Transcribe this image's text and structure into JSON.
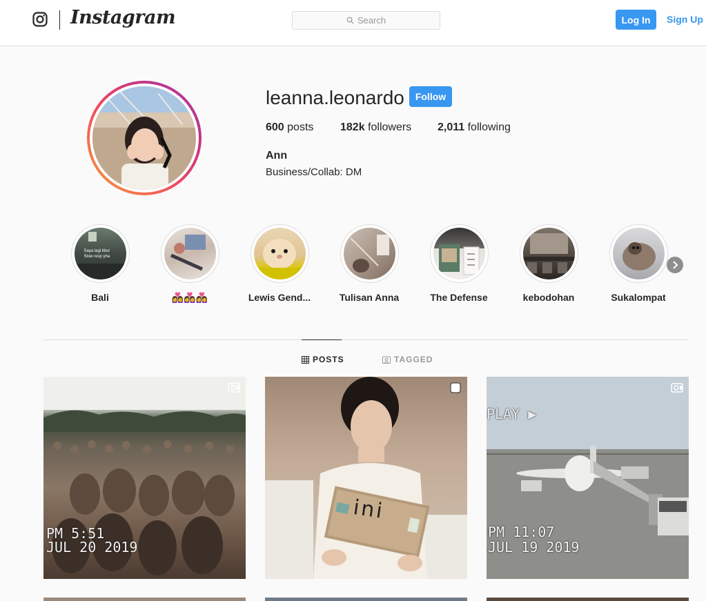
{
  "header": {
    "logo_wordmark": "Instagram",
    "search_placeholder": "Search",
    "login_label": "Log In",
    "signup_label": "Sign Up"
  },
  "profile": {
    "username": "leanna.leonardo",
    "follow_label": "Follow",
    "stats": {
      "posts_count": "600",
      "posts_label": "posts",
      "followers_count": "182k",
      "followers_label": "followers",
      "following_count": "2,011",
      "following_label": "following"
    },
    "full_name": "Ann",
    "bio": "Business/Collab: DM"
  },
  "highlights": [
    {
      "label": "Bali",
      "caption": "Saya lagi libur\nSlow resp yha"
    },
    {
      "label": "👩‍❤️‍👩👩‍❤️‍👩👩‍❤️‍👩"
    },
    {
      "label": "Lewis Gend..."
    },
    {
      "label": "Tulisan Anna"
    },
    {
      "label": "The Defense"
    },
    {
      "label": "kebodohan"
    },
    {
      "label": "Sukalompat"
    }
  ],
  "tabs": {
    "posts_label": "POSTS",
    "tagged_label": "TAGGED"
  },
  "posts": [
    {
      "type": "video",
      "overlay_line1": "PM  5:51",
      "overlay_line2": "JUL 20 2019"
    },
    {
      "type": "multiple",
      "overlay_text": "ini"
    },
    {
      "type": "video",
      "overlay_line0": "PLAY ▶",
      "overlay_line1": "PM  11:07",
      "overlay_line2": "JUL 19 2019"
    }
  ],
  "icons": {
    "logo": "instagram-glyph-icon",
    "search": "search-icon",
    "next": "chevron-right-icon",
    "posts_tab": "grid-icon",
    "tagged_tab": "tagged-icon",
    "video": "video-camera-icon",
    "multiple": "multiple-posts-icon"
  },
  "colors": {
    "accent": "#3897f0",
    "text": "#262626",
    "muted": "#999999",
    "border": "#dbdbdb",
    "background": "#fafafa"
  }
}
